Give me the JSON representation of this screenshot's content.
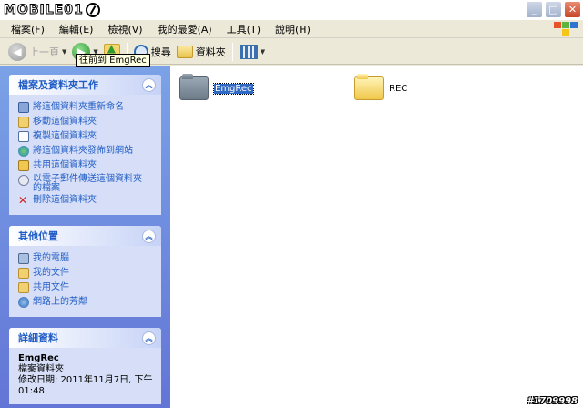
{
  "window": {
    "logo_text": "MOBILE01",
    "buttons": {
      "minimize": "_",
      "maximize": "□",
      "close": "✕"
    }
  },
  "menubar": {
    "items": [
      "檔案(F)",
      "編輯(E)",
      "檢視(V)",
      "我的最愛(A)",
      "工具(T)",
      "說明(H)"
    ]
  },
  "toolbar": {
    "back_label": "上一頁",
    "search_label": "搜尋",
    "folders_label": "資料夾",
    "tooltip": "往前到 EmgRec"
  },
  "sidebar": {
    "file_tasks": {
      "title": "檔案及資料夾工作",
      "items": [
        {
          "label": "將這個資料夾重新命名",
          "icon": "rename-icon"
        },
        {
          "label": "移動這個資料夾",
          "icon": "move-icon"
        },
        {
          "label": "複製這個資料夾",
          "icon": "copy-icon"
        },
        {
          "label": "將這個資料夾發佈到網站",
          "icon": "publish-web-icon"
        },
        {
          "label": "共用這個資料夾",
          "icon": "share-icon"
        },
        {
          "label": "以電子郵件傳送這個資料夾的檔案",
          "icon": "email-icon"
        },
        {
          "label": "刪除這個資料夾",
          "icon": "delete-icon"
        }
      ]
    },
    "other_places": {
      "title": "其他位置",
      "items": [
        {
          "label": "我的電腦",
          "icon": "my-computer-icon"
        },
        {
          "label": "我的文件",
          "icon": "my-documents-icon"
        },
        {
          "label": "共用文件",
          "icon": "shared-documents-icon"
        },
        {
          "label": "網路上的芳鄰",
          "icon": "network-places-icon"
        }
      ]
    },
    "details": {
      "title": "詳細資料",
      "name": "EmgRec",
      "type": "檔案資料夾",
      "modified": "修改日期: 2011年11月7日, 下午 01:48"
    }
  },
  "content": {
    "items": [
      {
        "name": "EmgRec",
        "selected": true
      },
      {
        "name": "REC",
        "selected": false
      }
    ]
  },
  "watermark": "#1709998"
}
